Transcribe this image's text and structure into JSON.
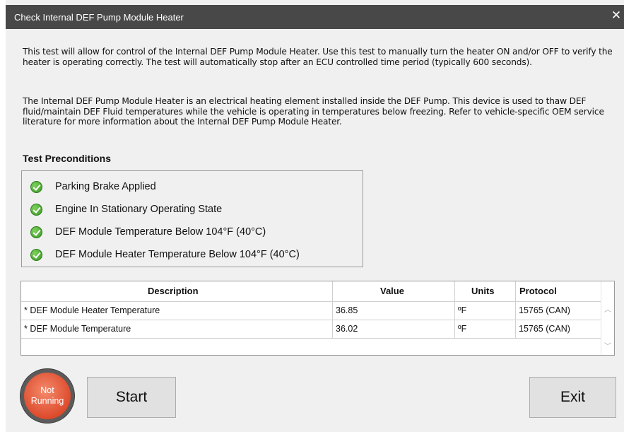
{
  "window": {
    "title": "Check Internal DEF Pump Module Heater",
    "close_glyph": "✕"
  },
  "description": {
    "paragraph1": "This test will allow for control of the Internal DEF Pump Module Heater. Use this test to manually turn the heater ON and/or OFF to verify the heater is operating correctly. The test will automatically stop after an ECU controlled time period (typically 600 seconds).",
    "paragraph2": "The Internal DEF Pump Module Heater is an electrical heating element installed inside the DEF Pump. This device is used to thaw DEF fluid/maintain DEF Fluid temperatures while the vehicle is operating in temperatures below freezing. Refer to vehicle-specific OEM service literature for more information about the Internal DEF Pump Module Heater."
  },
  "preconditions": {
    "heading": "Test Preconditions",
    "items": [
      {
        "label": "Parking Brake Applied",
        "icon": "check-circle-icon",
        "status_color": "#3a9a22"
      },
      {
        "label": "Engine In Stationary Operating State",
        "icon": "check-circle-icon",
        "status_color": "#3a9a22"
      },
      {
        "label": "DEF Module Temperature Below 104°F (40°C)",
        "icon": "check-circle-icon",
        "status_color": "#3a9a22"
      },
      {
        "label": "DEF Module Heater Temperature Below 104°F (40°C)",
        "icon": "check-circle-icon",
        "status_color": "#3a9a22"
      }
    ]
  },
  "table": {
    "headers": {
      "description": "Description",
      "value": "Value",
      "units": "Units",
      "protocol": "Protocol"
    },
    "rows": [
      {
        "description": "* DEF Module Heater Temperature",
        "value": "36.85",
        "units": "ºF",
        "protocol": "15765 (CAN)"
      },
      {
        "description": "* DEF Module Temperature",
        "value": "36.02",
        "units": "ºF",
        "protocol": "15765 (CAN)"
      }
    ]
  },
  "status": {
    "line1": "Not",
    "line2": "Running",
    "color": "#dd4b2c"
  },
  "buttons": {
    "start": "Start",
    "exit": "Exit"
  }
}
